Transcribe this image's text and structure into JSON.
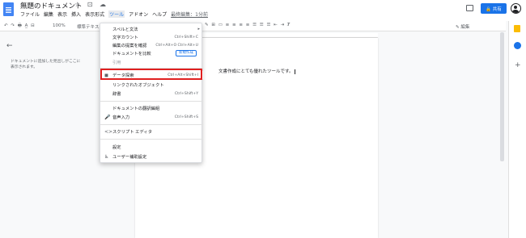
{
  "header": {
    "doc_title": "無題のドキュメント",
    "title_icons": "☆ ⊡ ☁",
    "menu": [
      "ファイル",
      "編集",
      "表示",
      "挿入",
      "表示形式",
      "ツール",
      "アドオン",
      "ヘルプ"
    ],
    "last_edit": "最終編集：1分前",
    "share_label": "🔒 共有"
  },
  "toolbar": {
    "left_icons": "↶ ↷ 🖶 A̲ ⊟",
    "zoom": "100%",
    "style": "標準テキスト",
    "right_icons": "✎ ⊞ ▭ ≡ ≡ ≡ ≡ ☰ ☰ ☰ ⇤ ⇥ Ⱦ",
    "mode": "✎ 編集"
  },
  "outline": {
    "back": "←",
    "text": "ドキュメントに追加した見出しがここに表示されます。"
  },
  "document": {
    "body_text": "文書作成にとても優れたツールです。"
  },
  "tools_menu": {
    "items": [
      {
        "label": "スペルと文法",
        "shortcut": "",
        "icon": "",
        "arrow": "▸"
      },
      {
        "label": "文字カウント",
        "shortcut": "Ctrl+Shift+C",
        "icon": ""
      },
      {
        "label": "編集の提案を確認",
        "shortcut": "Ctrl+Alt+O Ctrl+Alt+U",
        "icon": ""
      },
      {
        "label": "ドキュメントを比較",
        "badge": "新規作成",
        "icon": ""
      },
      {
        "label": "引用",
        "shortcut": "",
        "icon": "",
        "disabled": true
      },
      {
        "label": "データ探索",
        "shortcut": "Ctrl+Alt+Shift+I",
        "icon": "◼"
      },
      {
        "label": "リンクされたオブジェクト",
        "shortcut": "",
        "icon": ""
      },
      {
        "label": "辞書",
        "shortcut": "Ctrl+Shift+Y",
        "icon": ""
      },
      {
        "label": "ドキュメントの翻訳編組",
        "shortcut": "",
        "icon": ""
      },
      {
        "label": "音声入力",
        "shortcut": "Ctrl+Shift+S",
        "icon": "🎤"
      },
      {
        "label": "スクリプト エディタ",
        "shortcut": "",
        "icon": "<>"
      },
      {
        "label": "設定",
        "shortcut": "",
        "icon": ""
      },
      {
        "label": "ユーザー補助設定",
        "shortcut": "",
        "icon": "♿"
      }
    ]
  },
  "colors": {
    "accent": "#1a73e8",
    "highlight_border": "#e02020"
  }
}
